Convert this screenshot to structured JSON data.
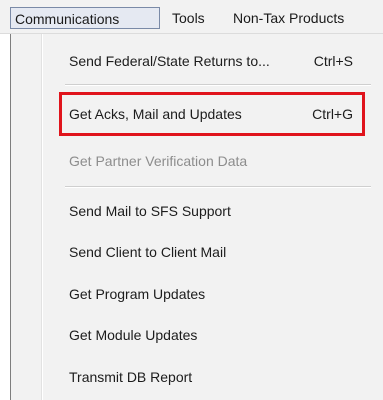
{
  "menubar": {
    "items": [
      {
        "label": "Communications"
      },
      {
        "label": "Tools"
      },
      {
        "label": "Non-Tax Products"
      }
    ]
  },
  "dropdown": {
    "items": [
      {
        "label": "Send Federal/State Returns to...",
        "shortcut": "Ctrl+S",
        "enabled": true
      },
      {
        "label": "Get Acks, Mail and Updates",
        "shortcut": "Ctrl+G",
        "enabled": true,
        "highlighted": true
      },
      {
        "label": "Get Partner Verification Data",
        "shortcut": "",
        "enabled": false
      },
      {
        "label": "Send Mail to SFS Support",
        "shortcut": "",
        "enabled": true
      },
      {
        "label": "Send Client to Client Mail",
        "shortcut": "",
        "enabled": true
      },
      {
        "label": "Get Program Updates",
        "shortcut": "",
        "enabled": true
      },
      {
        "label": "Get Module Updates",
        "shortcut": "",
        "enabled": true
      },
      {
        "label": "Transmit DB Report",
        "shortcut": "",
        "enabled": true
      }
    ]
  },
  "colors": {
    "highlight_border": "#e0141c",
    "disabled_text": "#8d8d8d",
    "menu_background": "#f2f2f2"
  }
}
